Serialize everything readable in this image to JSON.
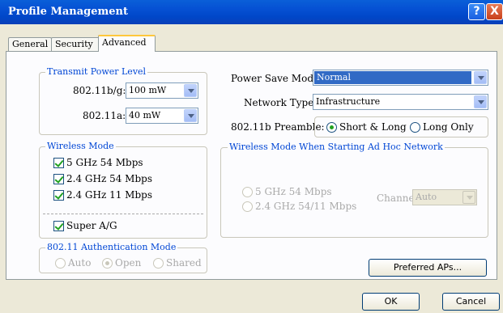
{
  "window": {
    "title": "Profile Management",
    "help_glyph": "?",
    "close_glyph": "X"
  },
  "tabs": [
    "General",
    "Security",
    "Advanced"
  ],
  "active_tab": "Advanced",
  "transmit_power": {
    "legend": "Transmit Power Level",
    "bg_label": "802.11b/g:",
    "bg_value": "100 mW",
    "a_label": "802.11a:",
    "a_value": "40 mW"
  },
  "wireless_mode": {
    "legend": "Wireless Mode",
    "options": [
      "5 GHz 54 Mbps",
      "2.4 GHz 54 Mbps",
      "2.4 GHz 11 Mbps"
    ],
    "super_ag": "Super A/G"
  },
  "auth_mode": {
    "legend": "802.11 Authentication Mode",
    "options": [
      "Auto",
      "Open",
      "Shared"
    ],
    "selected": "Open"
  },
  "power_save": {
    "label": "Power Save Mode:",
    "value": "Normal"
  },
  "network_type": {
    "label": "Network Type:",
    "value": "Infrastructure"
  },
  "preamble": {
    "label": "802.11b Preamble:",
    "options": [
      "Short & Long",
      "Long Only"
    ],
    "selected": "Short & Long"
  },
  "adhoc": {
    "legend": "Wireless Mode When Starting Ad Hoc Network",
    "options": [
      "5 GHz 54 Mbps",
      "2.4 GHz 54/11 Mbps"
    ],
    "channel_label": "Channel:",
    "channel_value": "Auto"
  },
  "buttons": {
    "preferred": "Preferred APs...",
    "ok": "OK",
    "cancel": "Cancel"
  },
  "colors": {
    "accent": "#0046d5",
    "titlebar": "#0651d4",
    "check": "#21a121"
  }
}
